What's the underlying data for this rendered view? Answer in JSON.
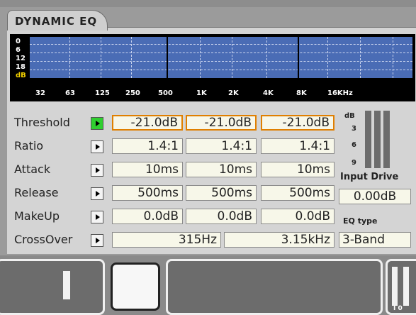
{
  "title": "DYNAMIC EQ",
  "spectrum": {
    "db_labels": [
      "0",
      "6",
      "12",
      "18",
      "dB"
    ],
    "freq_labels": [
      "32",
      "63",
      "125",
      "250",
      "500",
      "1K",
      "2K",
      "4K",
      "8K",
      "16KHz"
    ]
  },
  "rows": [
    {
      "label": "Threshold",
      "values": [
        "-21.0dB",
        "-21.0dB",
        "-21.0dB"
      ],
      "active": true
    },
    {
      "label": "Ratio",
      "values": [
        "1.4:1",
        "1.4:1",
        "1.4:1"
      ]
    },
    {
      "label": "Attack",
      "values": [
        "10ms",
        "10ms",
        "10ms"
      ]
    },
    {
      "label": "Release",
      "values": [
        "500ms",
        "500ms",
        "500ms"
      ]
    },
    {
      "label": "MakeUp",
      "values": [
        "0.0dB",
        "0.0dB",
        "0.0dB"
      ]
    }
  ],
  "crossover": {
    "label": "CrossOver",
    "low": "315Hz",
    "high": "3.15kHz"
  },
  "meter_scale": [
    "dB",
    "3",
    "6",
    "9"
  ],
  "input_drive": {
    "label": "Input Drive",
    "value": "0.00dB"
  },
  "eq_type": {
    "label": "EQ type",
    "value": "3-Band"
  },
  "bottom_meter_ticks": "I  0"
}
